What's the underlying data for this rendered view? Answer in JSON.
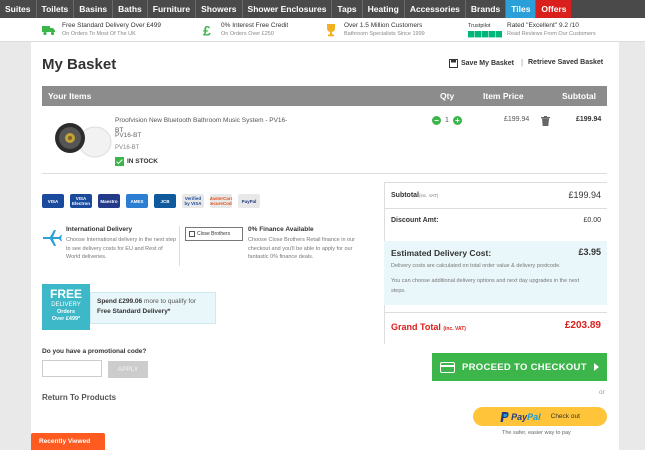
{
  "nav": {
    "items": [
      "Suites",
      "Toilets",
      "Basins",
      "Baths",
      "Furniture",
      "Showers",
      "Shower Enclosures",
      "Taps",
      "Heating",
      "Accessories",
      "Brands",
      "Tiles",
      "Offers"
    ]
  },
  "usp": {
    "delivery_title": "Free Standard Delivery Over £499",
    "delivery_sub": "On Orders To Most Of The UK",
    "credit_title": "0% Interest Free Credit",
    "credit_sub": "On Orders Over £250",
    "customers_title": "Over 1.5 Million Customers",
    "customers_sub": "Bathroom Specialists Since 1999",
    "trustpilot_brand": "Trustpilot",
    "trustpilot_title": "Rated \"Excellent\" 9.2 /10",
    "trustpilot_sub": "Read Reviews From Our Customers"
  },
  "basket": {
    "title": "My Basket",
    "save_label": "Save My Basket",
    "separator": "|",
    "retrieve_label": "Retrieve Saved Basket",
    "headers": {
      "items": "Your Items",
      "qty": "Qty",
      "price": "Item Price",
      "subtotal": "Subtotal"
    },
    "item": {
      "name": "Proofvision New Bluetooth Bathroom Music System - PV16-BT",
      "code": "PV16-BT",
      "code2": "PV16-BT",
      "stock": "IN STOCK",
      "qty": "1",
      "price": "£199.94",
      "subtotal": "£199.94"
    }
  },
  "payment_cards": [
    {
      "label": "VISA",
      "color": "#1a4a9c"
    },
    {
      "label": "VISA Electron",
      "color": "#1a4a9c"
    },
    {
      "label": "Maestro",
      "color": "#233a88"
    },
    {
      "label": "AMEX",
      "color": "#2c7ed2"
    },
    {
      "label": "JCB",
      "color": "#0f5a9c"
    },
    {
      "label": "Verified by VISA",
      "color": "#e8e8e8"
    },
    {
      "label": "MasterCard SecureCode",
      "color": "#e8e8e8"
    },
    {
      "label": "PayPal",
      "color": "#e8e8e8"
    }
  ],
  "info": {
    "intl_title": "International Delivery",
    "intl_text": "Choose International delivery in the next step to see delivery costs for EU and Rest of World deliveries.",
    "closebrothers": "Close Brothers",
    "finance_title": "0% Finance Available",
    "finance_text": "Choose Close Brothers Retail finance in our checkout and you'll be able to apply for our fantastic 0% finance deals."
  },
  "free_delivery": {
    "badge_free": "FREE",
    "badge_delivery": "DELIVERY",
    "badge_orders": "Orders",
    "badge_over": "Over £499*",
    "spend_prefix": "Spend £299.06",
    "spend_suffix": "more to qualify for",
    "line2": "Free Standard Delivery*"
  },
  "promo": {
    "label": "Do you have a promotional code?",
    "placeholder": "",
    "apply_label": "APPLY"
  },
  "return_link": "Return To Products",
  "summary": {
    "subtotal_label": "Subtotal",
    "subtotal_note": "(inc. VAT)",
    "subtotal_value": "£199.94",
    "discount_label": "Discount Amt:",
    "discount_value": "£0.00",
    "est_label": "Estimated Delivery Cost:",
    "est_value": "£3.95",
    "est_text1": "Delivery costs are calculated on total order value & delivery postcode.",
    "est_text2": "You can choose additional delivery options and next day upgrades in the next steps.",
    "grand_label": "Grand Total",
    "grand_note": "(inc. VAT)",
    "grand_value": "£203.89"
  },
  "checkout": {
    "label": "PROCEED TO CHECKOUT",
    "or": "or",
    "paypal_pay": "Pay",
    "paypal_pal": "Pal",
    "paypal_checkout": "Check out",
    "paypal_sub": "The safer, easier way to pay"
  },
  "recently_viewed": "Recently Viewed",
  "colors": {
    "accent_green": "#3cb54a",
    "nav_bg": "#4a4a4a",
    "tiles_blue": "#2a9fd8",
    "offers_red": "#d9201c",
    "paypal_yellow": "#ffc439"
  }
}
